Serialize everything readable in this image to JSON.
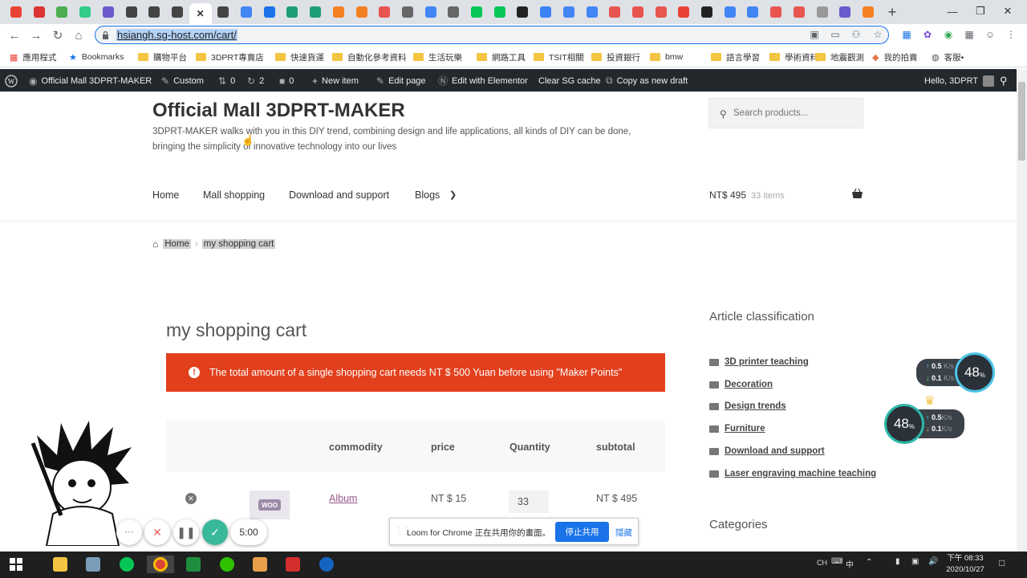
{
  "browser": {
    "url": "hsiangh.sg-host.com/cart/",
    "new_tab": "+",
    "tab_close": "✕",
    "window_controls": {
      "minimize": "—",
      "maximize": "❐",
      "close": "✕"
    },
    "bookmarks": [
      {
        "label": "應用程式",
        "icon": "apps-icon"
      },
      {
        "label": "Bookmarks",
        "icon": "star-icon"
      },
      {
        "label": "購物平台",
        "icon": "folder-icon"
      },
      {
        "label": "3DPRT專賣店",
        "icon": "folder-icon"
      },
      {
        "label": "快速貨運",
        "icon": "folder-icon"
      },
      {
        "label": "自動化參考資料",
        "icon": "folder-icon"
      },
      {
        "label": "生活玩樂",
        "icon": "folder-icon"
      },
      {
        "label": "網路工具",
        "icon": "folder-icon"
      },
      {
        "label": "TSIT相關",
        "icon": "folder-icon"
      },
      {
        "label": "投資銀行",
        "icon": "folder-icon"
      },
      {
        "label": "bmw",
        "icon": "folder-icon"
      },
      {
        "label": "語言學習",
        "icon": "folder-icon"
      },
      {
        "label": "學術資料",
        "icon": "folder-icon"
      },
      {
        "label": "地震觀測",
        "icon": "folder-icon"
      },
      {
        "label": "我的拍賣",
        "icon": "auction-icon"
      },
      {
        "label": "客服•",
        "icon": "globe-icon"
      }
    ]
  },
  "wp_admin": {
    "site_name": "Official Mall 3DPRT-MAKER",
    "customize": "Custom",
    "revisions": "0",
    "updates": "2",
    "comments": "0",
    "new_item": "New item",
    "edit_page": "Edit page",
    "elementor": "Edit with Elementor",
    "clear_cache": "Clear SG cache",
    "copy_draft": "Copy as new draft",
    "greeting": "Hello, 3DPRT"
  },
  "site": {
    "title": "Official Mall 3DPRT-MAKER",
    "tagline": "3DPRT-MAKER walks with you in this DIY trend, combining design and life applications, all kinds of DIY can be done, bringing the simplicity of innovative technology into our lives",
    "search_placeholder": "Search products...",
    "nav": [
      "Home",
      "Mall shopping",
      "Download and support",
      "Blogs"
    ],
    "cart_total": "NT$ 495",
    "cart_count": "33 items"
  },
  "breadcrumb": {
    "home": "Home",
    "current": "my shopping cart"
  },
  "cart": {
    "title": "my shopping cart",
    "notice": "The total amount of a single shopping cart needs NT $ 500 Yuan before using \"Maker Points\"",
    "columns": [
      "commodity",
      "price",
      "Quantity",
      "subtotal"
    ],
    "rows": [
      {
        "product": "Album",
        "price": "NT $ 15",
        "quantity": "33",
        "subtotal": "NT $ 495",
        "thumb_text": "WOO"
      }
    ]
  },
  "sidebar": {
    "article_heading": "Article classification",
    "article_categories": [
      "3D printer teaching",
      "Decoration",
      "Design trends",
      "Furniture",
      "Download and support",
      "Laser engraving machine teaching"
    ],
    "categories_heading": "Categories"
  },
  "net_monitor": [
    {
      "percent": "48",
      "up": "0.5",
      "down": "0.1",
      "unit": "K/s"
    },
    {
      "percent": "48",
      "up": "0.5",
      "down": "0.1",
      "unit": "K/s"
    }
  ],
  "recorder": {
    "more": "···",
    "timer": "5:00"
  },
  "loom": {
    "message": "Loom for Chrome 正在共用你的畫面。",
    "stop": "停止共用",
    "hide": "隱藏"
  },
  "taskbar": {
    "lang": "CH",
    "ime": "中",
    "time": "下午 08:33",
    "date": "2020/10/27"
  }
}
